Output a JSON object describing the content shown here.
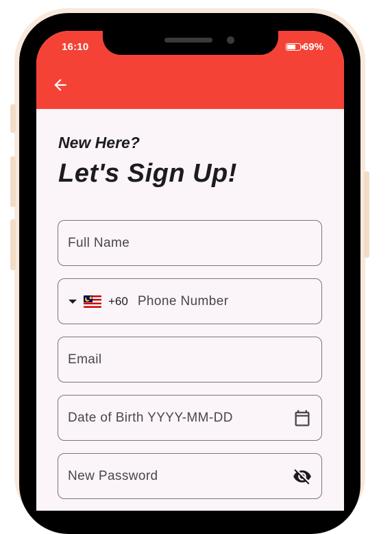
{
  "status_bar": {
    "time": "16:10",
    "battery": "69%"
  },
  "header": {
    "greeting": "New Here?",
    "title": "Let's Sign Up!"
  },
  "form": {
    "full_name_placeholder": "Full Name",
    "phone": {
      "country_flag": "Malaysia flag",
      "dial_code": "+60",
      "placeholder": "Phone Number"
    },
    "email_placeholder": "Email",
    "dob_placeholder": "Date of Birth YYYY-MM-DD",
    "password_placeholder": "New Password"
  },
  "icons": {
    "back": "back-arrow-icon",
    "calendar": "calendar-icon",
    "visibility": "visibility-off-icon",
    "dropdown": "dropdown-arrow-icon"
  },
  "colors": {
    "appbar": "#f44336",
    "background": "#fbf4f8",
    "outline": "#79747e",
    "frame": "#f8e9dc"
  }
}
